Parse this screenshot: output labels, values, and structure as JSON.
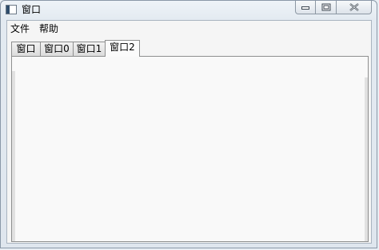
{
  "window": {
    "title": "窗口",
    "icon": "app-window-icon",
    "buttons": {
      "minimize": "minimize-icon",
      "maximize": "maximize-icon",
      "close": "close-icon"
    }
  },
  "menubar": {
    "items": [
      {
        "label": "文件"
      },
      {
        "label": "帮助"
      }
    ]
  },
  "tabs": {
    "items": [
      {
        "label": "窗口"
      },
      {
        "label": "窗口0"
      },
      {
        "label": "窗口1"
      },
      {
        "label": "窗口2"
      }
    ],
    "active_index": 3
  }
}
